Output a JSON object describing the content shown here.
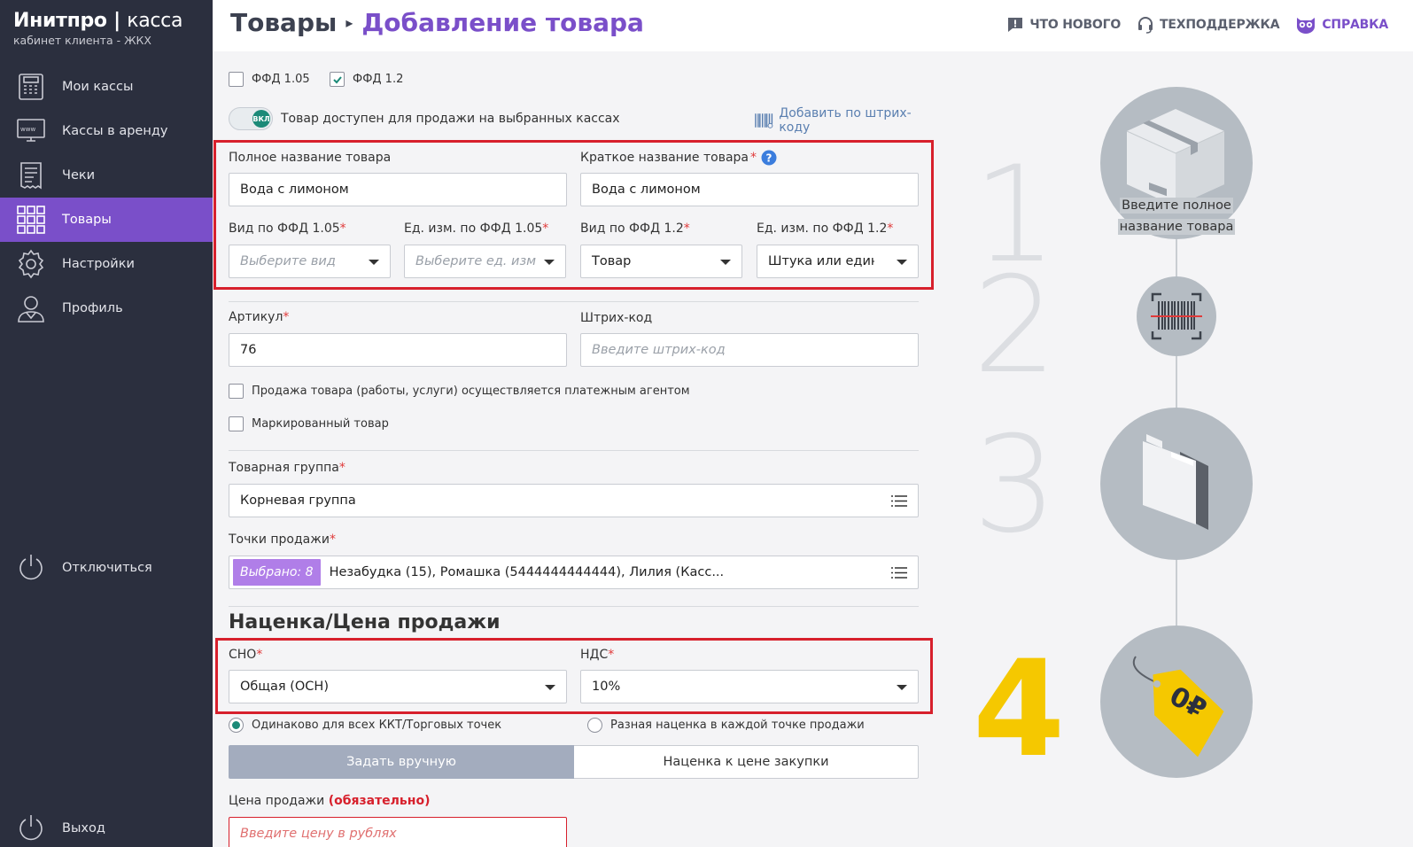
{
  "sidebar": {
    "brand_name": "Инитпро",
    "brand_name_thin": "касса",
    "brand_sub": "кабинет клиента - ЖКХ",
    "items": [
      {
        "label": "Мои кассы",
        "icon": "cash-register-icon"
      },
      {
        "label": "Кассы в аренду",
        "icon": "web-terminal-icon"
      },
      {
        "label": "Чеки",
        "icon": "receipt-icon"
      },
      {
        "label": "Товары",
        "icon": "grid-icon",
        "active": true
      },
      {
        "label": "Настройки",
        "icon": "gear-icon"
      },
      {
        "label": "Профиль",
        "icon": "user-icon"
      }
    ],
    "disconnect_label": "Отключиться",
    "exit_label": "Выход"
  },
  "header": {
    "crumb1": "Товары",
    "crumb2": "Добавление товара",
    "whats_new": "ЧТО НОВОГО",
    "support": "ТЕХПОДДЕРЖКА",
    "help": "СПРАВКА"
  },
  "form": {
    "ffd105_label": "ФФД 1.05",
    "ffd12_label": "ФФД 1.2",
    "toggle_knob": "ВКЛ",
    "toggle_label": "Товар доступен для продажи на выбранных кассах",
    "add_barcode": "Добавить по штрих-коду",
    "full_name_label": "Полное название товара",
    "full_name_value": "Вода с лимоном",
    "short_name_label": "Краткое название товара",
    "short_name_value": "Вода с лимоном",
    "kind105_label": "Вид по ФФД 1.05",
    "kind105_placeholder": "Выберите вид",
    "unit105_label": "Ед. изм. по ФФД 1.05",
    "unit105_placeholder": "Выберите ед. изм",
    "kind12_label": "Вид по ФФД 1.2",
    "kind12_value": "Товар",
    "unit12_label": "Ед. изм. по ФФД 1.2",
    "unit12_value": "Штука или единица",
    "article_label": "Артикул",
    "article_value": "76",
    "barcode_label": "Штрих-код",
    "barcode_placeholder": "Введите штрих-код",
    "agent_label": "Продажа товара (работы, услуги) осуществляется платежным агентом",
    "marked_label": "Маркированный товар",
    "group_label": "Товарная группа",
    "group_value": "Корневая группа",
    "points_label": "Точки продажи",
    "points_badge": "Выбрано: 8",
    "points_value": "Незабудка (15), Ромашка (5444444444444), Лилия (Касс...",
    "markup_title": "Наценка/Цена продажи",
    "sno_label": "СНО",
    "sno_value": "Общая (ОСН)",
    "nds_label": "НДС",
    "nds_value": "10%",
    "radio_same": "Одинаково для всех ККТ/Торговых точек",
    "radio_diff": "Разная наценка в каждой точке продажи",
    "seg_manual": "Задать вручную",
    "seg_markup": "Наценка к цене закупки",
    "price_label": "Цена продажи",
    "price_required": "(обязательно)",
    "price_placeholder": "Введите цену в рублях"
  },
  "steps": {
    "n1": "1",
    "n2": "2",
    "n3": "3",
    "n4": "4",
    "step1_line1": "Введите полное",
    "step1_line2": "название товара",
    "price_tag": "0₽"
  },
  "colors": {
    "accent": "#7a4fc9",
    "sidebar_bg": "#2b2f3e",
    "highlight": "#d7202c",
    "step4": "#f5c800"
  }
}
